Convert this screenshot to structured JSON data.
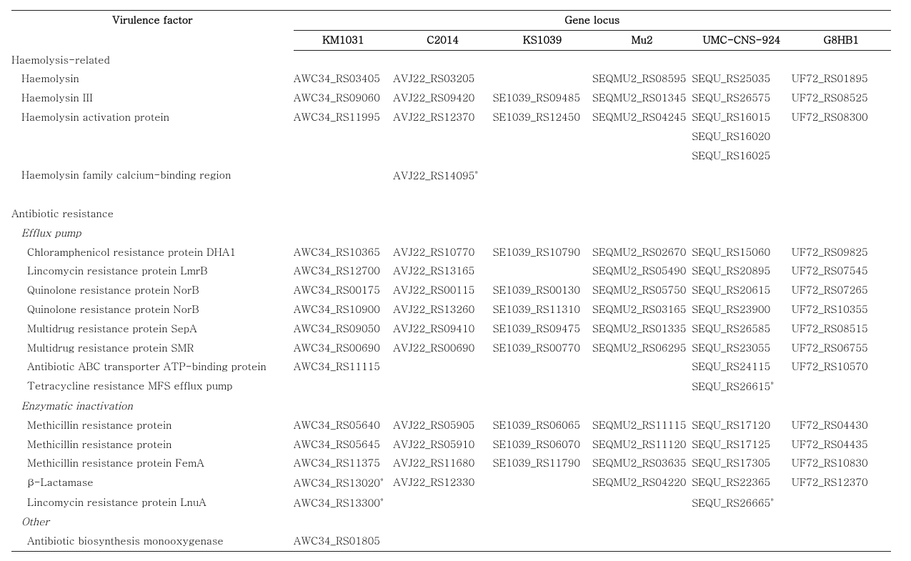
{
  "headers": {
    "vf": "Virulence factor",
    "gene_locus": "Gene locus",
    "strains": [
      "KM1031",
      "C2014",
      "KS1039",
      "Mu2",
      "UMC-CNS-924",
      "G8HB1"
    ]
  },
  "rows": [
    {
      "kind": "section",
      "indent": 0,
      "label": "Haemolysis-related"
    },
    {
      "kind": "data",
      "indent": 1,
      "label": "Haemolysin",
      "cells": [
        "AWC34_RS03405",
        "AVJ22_RS03205",
        "",
        "SEQMU2_RS08595",
        "SEQU_RS25035",
        "UF72_RS01895"
      ]
    },
    {
      "kind": "data",
      "indent": 1,
      "label": "Haemolysin III",
      "cells": [
        "AWC34_RS09060",
        "AVJ22_RS09420",
        "SE1039_RS09485",
        "SEQMU2_RS01345",
        "SEQU_RS26575",
        "UF72_RS08525"
      ]
    },
    {
      "kind": "data",
      "indent": 1,
      "label": "Haemolysin activation protein",
      "cells": [
        "AWC34_RS11995",
        "AVJ22_RS12370",
        "SE1039_RS12450",
        "SEQMU2_RS04245",
        "SEQU_RS16015",
        "UF72_RS08300"
      ]
    },
    {
      "kind": "cont",
      "cells": [
        "",
        "",
        "",
        "",
        "SEQU_RS16020",
        ""
      ]
    },
    {
      "kind": "cont",
      "cells": [
        "",
        "",
        "",
        "",
        "SEQU_RS16025",
        ""
      ]
    },
    {
      "kind": "data",
      "indent": 1,
      "label": "Haemolysin family calcium-binding region",
      "cells": [
        "",
        "AVJ22_RS14095*",
        "",
        "",
        "",
        ""
      ]
    },
    {
      "kind": "spacer"
    },
    {
      "kind": "section",
      "indent": 0,
      "label": "Antibiotic resistance"
    },
    {
      "kind": "section",
      "indent": 1,
      "italic": true,
      "label": "Efflux pump"
    },
    {
      "kind": "data",
      "indent": 2,
      "label": "Chloramphenicol resistance protein DHA1",
      "cells": [
        "AWC34_RS10365",
        "AVJ22_RS10770",
        "SE1039_RS10790",
        "SEQMU2_RS02670",
        "SEQU_RS15060",
        "UF72_RS09825"
      ]
    },
    {
      "kind": "data",
      "indent": 2,
      "label": "Lincomycin resistance protein LmrB",
      "cells": [
        "AWC34_RS12700",
        "AVJ22_RS13165",
        "",
        "SEQMU2_RS05490",
        "SEQU_RS20895",
        "UF72_RS07545"
      ]
    },
    {
      "kind": "data",
      "indent": 2,
      "label": "Quinolone resistance protein NorB",
      "cells": [
        "AWC34_RS00175",
        "AVJ22_RS00115",
        "SE1039_RS00130",
        "SEQMU2_RS05750",
        "SEQU_RS20615",
        "UF72_RS07265"
      ]
    },
    {
      "kind": "data",
      "indent": 2,
      "label": "Quinolone resistance protein NorB",
      "cells": [
        "AWC34_RS10900",
        "AVJ22_RS13260",
        "SE1039_RS11310",
        "SEQMU2_RS03165",
        "SEQU_RS23900",
        "UF72_RS10355"
      ]
    },
    {
      "kind": "data",
      "indent": 2,
      "label": "Multidrug resistance protein SepA",
      "cells": [
        "AWC34_RS09050",
        "AVJ22_RS09410",
        "SE1039_RS09475",
        "SEQMU2_RS01335",
        "SEQU_RS26585",
        "UF72_RS08515"
      ]
    },
    {
      "kind": "data",
      "indent": 2,
      "label": "Multidrug resistance protein SMR",
      "cells": [
        "AWC34_RS00690",
        "AVJ22_RS00690",
        "SE1039_RS00770",
        "SEQMU2_RS06295",
        "SEQU_RS23055",
        "UF72_RS06755"
      ]
    },
    {
      "kind": "data",
      "indent": 2,
      "label": "Antibiotic ABC transporter ATP-binding protein",
      "cells": [
        "AWC34_RS11115",
        "",
        "",
        "",
        "SEQU_RS24115",
        "UF72_RS10570"
      ]
    },
    {
      "kind": "data",
      "indent": 2,
      "label": "Tetracycline resistance MFS efflux pump",
      "cells": [
        "",
        "",
        "",
        "",
        "SEQU_RS26615*",
        ""
      ]
    },
    {
      "kind": "section",
      "indent": 1,
      "italic": true,
      "label": "Enzymatic inactivation"
    },
    {
      "kind": "data",
      "indent": 2,
      "label": "Methicillin resistance protein",
      "cells": [
        "AWC34_RS05640",
        "AVJ22_RS05905",
        "SE1039_RS06065",
        "SEQMU2_RS11115",
        "SEQU_RS17120",
        "UF72_RS04430"
      ]
    },
    {
      "kind": "data",
      "indent": 2,
      "label": "Methicillin resistance protein",
      "cells": [
        "AWC34_RS05645",
        "AVJ22_RS05910",
        "SE1039_RS06070",
        "SEQMU2_RS11120",
        "SEQU_RS17125",
        "UF72_RS04435"
      ]
    },
    {
      "kind": "data",
      "indent": 2,
      "label": "Methicillin resistance protein FemA",
      "cells": [
        "AWC34_RS11375",
        "AVJ22_RS11680",
        "SE1039_RS11790",
        "SEQMU2_RS03635",
        "SEQU_RS17305",
        "UF72_RS10830"
      ]
    },
    {
      "kind": "data",
      "indent": 2,
      "label": "β-Lactamase",
      "cells": [
        "AWC34_RS13020*",
        "AVJ22_RS12330",
        "",
        "SEQMU2_RS04220",
        "SEQU_RS22365",
        "UF72_RS12370"
      ]
    },
    {
      "kind": "data",
      "indent": 2,
      "label": "Lincomycin resistance protein LnuA",
      "cells": [
        "AWC34_RS13300*",
        "",
        "",
        "",
        "SEQU_RS26665*",
        ""
      ]
    },
    {
      "kind": "section",
      "indent": 1,
      "italic": true,
      "label": "Other"
    },
    {
      "kind": "data",
      "indent": 2,
      "label": "Antibiotic biosynthesis monooxygenase",
      "cells": [
        "AWC34_RS01805",
        "",
        "",
        "",
        "",
        ""
      ],
      "last": true
    }
  ]
}
